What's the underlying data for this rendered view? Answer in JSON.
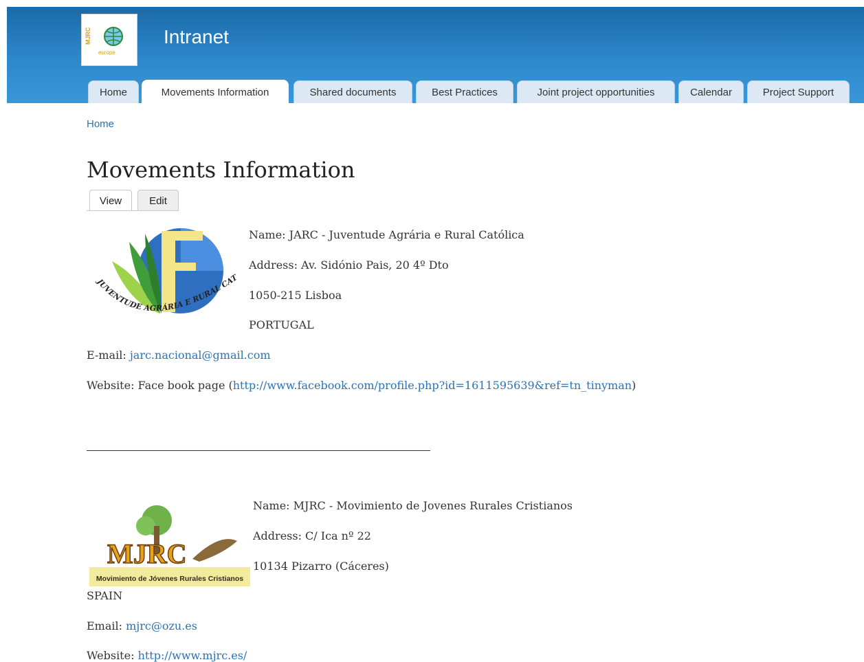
{
  "header": {
    "site_name": "Intranet",
    "logo_alt": "MJRC Europe",
    "brand_color": "#2f88cc"
  },
  "nav": {
    "tabs": [
      {
        "label": "Home"
      },
      {
        "label": "Movements Information"
      },
      {
        "label": "Shared documents"
      },
      {
        "label": "Best Practices"
      },
      {
        "label": "Joint project opportunities"
      },
      {
        "label": "Calendar"
      },
      {
        "label": "Project Support"
      }
    ],
    "active_tab": "Movements Information"
  },
  "breadcrumb": {
    "home": "Home"
  },
  "page": {
    "title": "Movements Information",
    "local_tabs": [
      {
        "label": "View"
      },
      {
        "label": "Edit"
      }
    ],
    "active_local_tab": "View"
  },
  "movements": [
    {
      "logo_text": "JUVENTUDE AGRÁRIA E RURAL CATÓLICA",
      "name_line": "Name: JARC - Juventude Agrária e Rural Católica",
      "address_line": "Address: Av. Sidónio Pais, 20 4º Dto",
      "city_line": "1050-215 Lisboa",
      "country": "PORTUGAL",
      "email_label": "E-mail:",
      "email": "jarc.nacional@gmail.com",
      "website_label": "Website: Face book page (",
      "website": "http://www.facebook.com/profile.php?id=1611595639&ref=tn_tinyman",
      "website_suffix": ")"
    },
    {
      "logo_text": "MJRC",
      "logo_caption": "Movimiento de Jóvenes Rurales Cristianos",
      "name_line": "Name: MJRC - Movimiento de Jovenes Rurales Cristianos",
      "address_line": "Address: C/ Ica nº 22",
      "city_line": "10134 Pizarro (Cáceres)",
      "country": "SPAIN",
      "email_label": "Email:",
      "email": "mjrc@ozu.es",
      "website_label": "Website:",
      "website": "http://www.mjrc.es/"
    }
  ]
}
